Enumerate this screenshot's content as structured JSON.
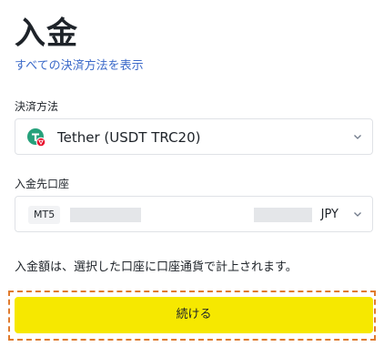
{
  "header": {
    "title": "入金",
    "show_all_link": "すべての決済方法を表示"
  },
  "method_field": {
    "label": "決済方法",
    "selected": "Tether (USDT TRC20)",
    "icon": "tether-icon"
  },
  "account_field": {
    "label": "入金先口座",
    "platform": "MT5",
    "currency": "JPY"
  },
  "note": "入金額は、選択した口座に口座通貨で計上されます。",
  "actions": {
    "continue_label": "続ける"
  },
  "colors": {
    "link": "#3c6ac9",
    "button": "#f6e800",
    "highlight_outline": "#e07b2e",
    "tether": "#26a17b",
    "tron_badge": "#e8112d"
  }
}
